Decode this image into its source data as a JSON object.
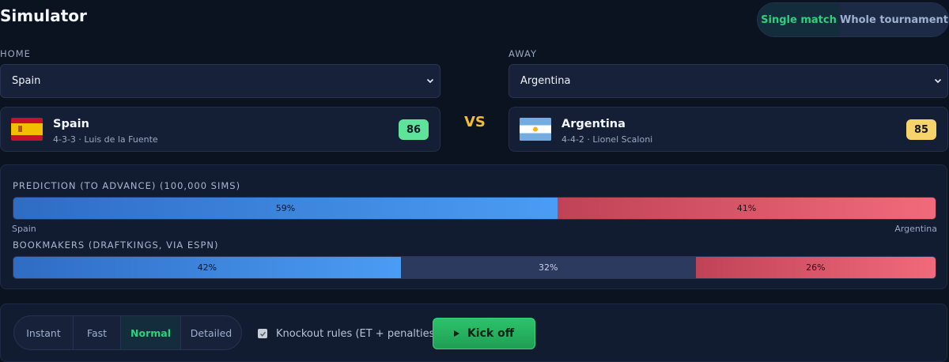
{
  "page": {
    "title": "Simulator"
  },
  "mode_toggle": {
    "options": [
      "Single match",
      "Whole tournament"
    ],
    "selected": "Single match"
  },
  "home": {
    "label": "HOME",
    "select_value": "Spain",
    "team": {
      "name": "Spain",
      "meta": "4-3-3 · Luis de la Fuente",
      "rating": "86",
      "rating_color": "#5fe39a",
      "flag": "spain-flag"
    }
  },
  "away": {
    "label": "AWAY",
    "select_value": "Argentina",
    "team": {
      "name": "Argentina",
      "meta": "4-4-2 · Lionel Scaloni",
      "rating": "85",
      "rating_color": "#f6d36b",
      "flag": "argentina-flag"
    }
  },
  "vs_label": "VS",
  "prediction": {
    "label": "PREDICTION (TO ADVANCE) (100,000 SIMS)",
    "home_pct": 59,
    "away_pct": 41,
    "home_text": "59%",
    "away_text": "41%",
    "home_team_label": "Spain",
    "away_team_label": "Argentina"
  },
  "bookmakers": {
    "label": "BOOKMAKERS (DRAFTKINGS, VIA ESPN)",
    "home_pct": 42,
    "draw_pct": 32,
    "away_pct": 26,
    "home_text": "42%",
    "draw_text": "32%",
    "away_text": "26%"
  },
  "controls": {
    "speed_options": [
      "Instant",
      "Fast",
      "Normal",
      "Detailed"
    ],
    "speed_selected": "Normal",
    "knockout_label": "Knockout rules (ET + penalties)",
    "knockout_checked": true,
    "kickoff_label": "Kick off"
  },
  "colors": {
    "accent_green": "#2fd07b",
    "vs": "#f2bd2e",
    "home_bar": "#4b9cf4",
    "away_bar": "#f16a7c"
  }
}
